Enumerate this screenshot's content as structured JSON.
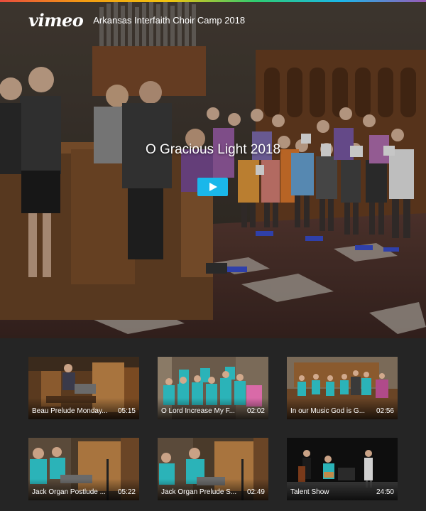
{
  "header": {
    "logo_text": "vimeo",
    "channel_title": "Arkansas Interfaith Choir Camp 2018"
  },
  "player": {
    "title": "O Gracious Light 2018",
    "play_icon": "play-icon",
    "accent_color": "#1ab7ea"
  },
  "videos": [
    {
      "title": "Beau Prelude Monday...",
      "duration": "05:15"
    },
    {
      "title": "O Lord Increase My F...",
      "duration": "02:02"
    },
    {
      "title": "In our Music God is G...",
      "duration": "02:56"
    },
    {
      "title": "Jack Organ Postlude ...",
      "duration": "05:22"
    },
    {
      "title": "Jack Organ Prelude S...",
      "duration": "02:49"
    },
    {
      "title": "Talent Show",
      "duration": "24:50"
    }
  ]
}
